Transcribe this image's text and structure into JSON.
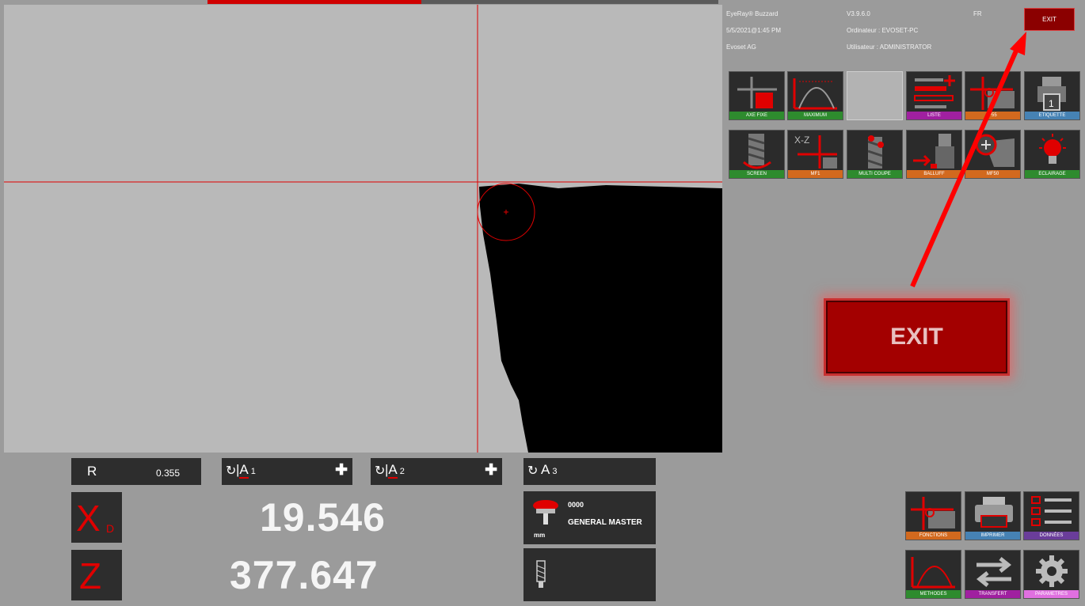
{
  "header": {
    "app_name": "EyeRay® Buzzard",
    "version": "V3.9.6.0",
    "language": "FR",
    "datetime": "5/5/2021@1:45 PM",
    "computer": "Ordinateur : EVOSET-PC",
    "company": "Evoset AG",
    "user": "Utilisateur : ADMINISTRATOR",
    "exit_label": "EXIT"
  },
  "tiles_row1": [
    {
      "label": "AXE FIXE",
      "color": "#2e8b2e",
      "icon": "fixed-axis-icon"
    },
    {
      "label": "MAXIMUM",
      "color": "#2e8b2e",
      "icon": "maximum-curve-icon"
    },
    {
      "label": "",
      "color": "",
      "icon": "empty-slot"
    },
    {
      "label": "LISTE",
      "color": "#a020a0",
      "icon": "list-add-icon"
    },
    {
      "label": "F55",
      "color": "#d2691e",
      "icon": "crosshair-corner-icon"
    },
    {
      "label": "ETIQUETTE",
      "color": "#4682b4",
      "icon": "label-printer-icon"
    }
  ],
  "tiles_row2": [
    {
      "label": "SCREEN",
      "color": "#2e8b2e",
      "icon": "screen-tool-icon"
    },
    {
      "label": "MF1",
      "color": "#d2691e",
      "icon": "xz-axis-icon"
    },
    {
      "label": "MULTI COUPE",
      "color": "#2e8b2e",
      "icon": "multi-cut-icon"
    },
    {
      "label": "BALLUFF",
      "color": "#d2691e",
      "icon": "balluff-icon"
    },
    {
      "label": "MF50",
      "color": "#d2691e",
      "icon": "zoom-plus-icon"
    },
    {
      "label": "ECLAIRAGE",
      "color": "#2e8b2e",
      "icon": "lightbulb-icon"
    }
  ],
  "callout": {
    "exit_label": "EXIT"
  },
  "measure": {
    "r_label": "R",
    "r_value": "0.355",
    "a1_label": "A",
    "a1_sub": "1",
    "a2_label": "A",
    "a2_sub": "2",
    "a3_label": "A",
    "a3_sub": "3",
    "x_label": "X",
    "x_sub": "D",
    "x_value": "19.546",
    "z_label": "Z",
    "z_value": "377.647"
  },
  "tool": {
    "number": "0000",
    "name": "GENERAL MASTER",
    "unit": "mm"
  },
  "bottom_tiles": [
    {
      "label": "FONCTIONS",
      "color": "#d2691e",
      "icon": "functions-icon"
    },
    {
      "label": "IMPRIMER",
      "color": "#4682b4",
      "icon": "printer-icon"
    },
    {
      "label": "DONNÉES",
      "color": "#6a3d9a",
      "icon": "data-checklist-icon"
    },
    {
      "label": "METHODES",
      "color": "#2e8b2e",
      "icon": "methods-curve-icon"
    },
    {
      "label": "TRANSFERT",
      "color": "#a020a0",
      "icon": "transfer-arrows-icon"
    },
    {
      "label": "PARAMETRES",
      "color": "#e070e0",
      "icon": "gear-icon"
    }
  ],
  "colors": {
    "accent_red": "#e00000",
    "panel_dark": "#2d2d2d",
    "background": "#9b9b9b"
  }
}
